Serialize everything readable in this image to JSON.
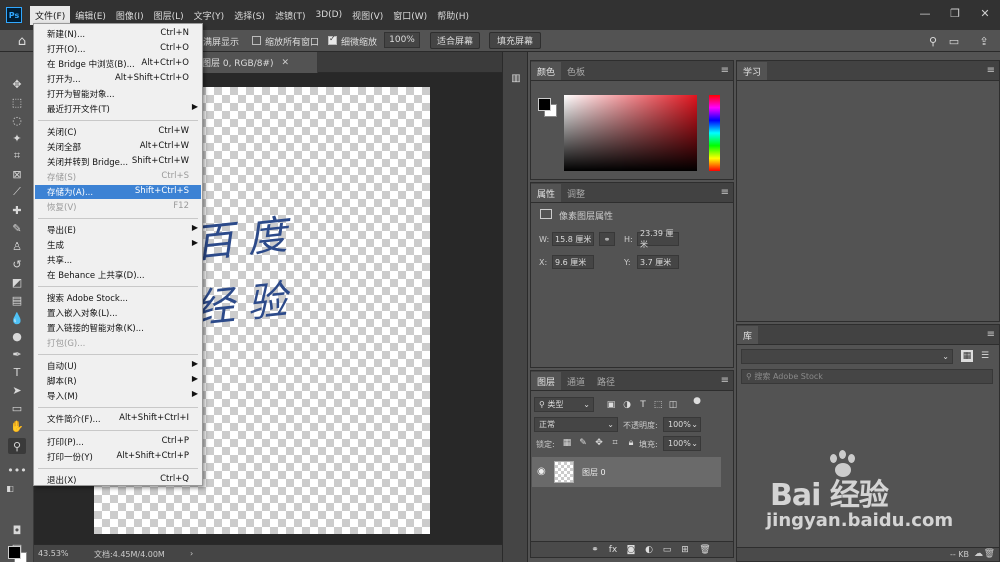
{
  "app": {
    "logo_text": "Ps"
  },
  "menubar": {
    "items": [
      "文件(F)",
      "编辑(E)",
      "图像(I)",
      "图层(L)",
      "文字(Y)",
      "选择(S)",
      "滤镜(T)",
      "3D(D)",
      "视图(V)",
      "窗口(W)",
      "帮助(H)"
    ],
    "active_index": 0
  },
  "window_controls": {
    "minimize": "—",
    "restore": "❐",
    "close": "✕"
  },
  "options_bar": {
    "fullscreen_label": "满屏显示",
    "zoom_all_label": "缩放所有窗口",
    "scrubby_zoom_label": "细微缩放",
    "zoom_value": "100%",
    "fit_screen_label": "适合屏幕",
    "fill_screen_label": "填充屏幕"
  },
  "document": {
    "tab_title": "图层 0, RGB/8#)",
    "handwriting_line1": "百 度",
    "handwriting_line2": "经 验"
  },
  "status_bar": {
    "zoom": "43.53%",
    "doc_size": "文档:4.45M/4.00M"
  },
  "file_menu": {
    "items": [
      {
        "label": "新建(N)...",
        "shortcut": "Ctrl+N"
      },
      {
        "label": "打开(O)...",
        "shortcut": "Ctrl+O"
      },
      {
        "label": "在 Bridge 中浏览(B)...",
        "shortcut": "Alt+Ctrl+O"
      },
      {
        "label": "打开为...",
        "shortcut": "Alt+Shift+Ctrl+O"
      },
      {
        "label": "打开为智能对象..."
      },
      {
        "label": "最近打开文件(T)",
        "submenu": true
      },
      {
        "label": "关闭(C)",
        "shortcut": "Ctrl+W"
      },
      {
        "label": "关闭全部",
        "shortcut": "Alt+Ctrl+W"
      },
      {
        "label": "关闭并转到 Bridge...",
        "shortcut": "Shift+Ctrl+W"
      },
      {
        "label": "存储(S)",
        "shortcut": "Ctrl+S",
        "disabled": true
      },
      {
        "label": "存储为(A)...",
        "shortcut": "Shift+Ctrl+S",
        "highlight": true
      },
      {
        "label": "恢复(V)",
        "shortcut": "F12",
        "disabled": true
      },
      {
        "label": "导出(E)",
        "submenu": true
      },
      {
        "label": "生成",
        "submenu": true
      },
      {
        "label": "共享..."
      },
      {
        "label": "在 Behance 上共享(D)..."
      },
      {
        "label": "搜索 Adobe Stock..."
      },
      {
        "label": "置入嵌入对象(L)..."
      },
      {
        "label": "置入链接的智能对象(K)..."
      },
      {
        "label": "打包(G)...",
        "disabled": true
      },
      {
        "label": "自动(U)",
        "submenu": true
      },
      {
        "label": "脚本(R)",
        "submenu": true
      },
      {
        "label": "导入(M)",
        "submenu": true
      },
      {
        "label": "文件简介(F)...",
        "shortcut": "Alt+Shift+Ctrl+I"
      },
      {
        "label": "打印(P)...",
        "shortcut": "Ctrl+P"
      },
      {
        "label": "打印一份(Y)",
        "shortcut": "Alt+Shift+Ctrl+P"
      },
      {
        "label": "退出(X)",
        "shortcut": "Ctrl+Q"
      }
    ]
  },
  "color_panel": {
    "tabs": [
      "颜色",
      "色板"
    ]
  },
  "properties_panel": {
    "tabs": [
      "属性",
      "调整"
    ],
    "subtitle": "像素图层属性",
    "w_label": "W:",
    "w_value": "15.8 厘米",
    "h_label": "H:",
    "h_value": "23.39 厘米",
    "x_label": "X:",
    "x_value": "9.6 厘米",
    "y_label": "Y:",
    "y_value": "3.7 厘米"
  },
  "layers_panel": {
    "tabs": [
      "图层",
      "通道",
      "路径"
    ],
    "filter_kind": "类型",
    "blend_mode": "正常",
    "opacity_label": "不透明度:",
    "opacity_value": "100%",
    "lock_label": "锁定:",
    "fill_label": "填充:",
    "fill_value": "100%",
    "layer_name": "图层 0"
  },
  "learn_panel": {
    "tab": "学习"
  },
  "library_panel": {
    "tab": "库",
    "search_placeholder": "搜索 Adobe Stock",
    "size_label": "-- KB"
  },
  "watermark": {
    "logo": "Bai  经验",
    "url": "jingyan.baidu.com"
  }
}
